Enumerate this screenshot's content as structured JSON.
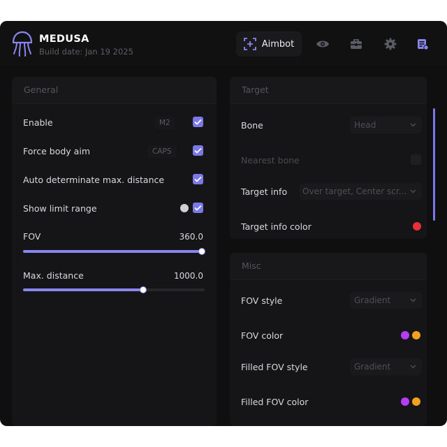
{
  "header": {
    "title": "MEDUSA",
    "build_date": "Build date: Jan 19 2025",
    "tabs": [
      {
        "label": "Aimbot",
        "icon": "crosshair-icon",
        "active": true
      },
      {
        "label": "",
        "icon": "eye-icon"
      },
      {
        "label": "",
        "icon": "toolbox-icon"
      },
      {
        "label": "",
        "icon": "gear-icon"
      },
      {
        "label": "",
        "icon": "config-list-icon"
      }
    ]
  },
  "general": {
    "title": "General",
    "enable": {
      "label": "Enable",
      "key": "M2",
      "checked": true
    },
    "force_body_aim": {
      "label": "Force body aim",
      "key": "CAPS",
      "checked": true
    },
    "auto_max_distance": {
      "label": "Auto determinate max. distance",
      "checked": true
    },
    "show_limit_range": {
      "label": "Show limit range",
      "checked": true
    },
    "fov": {
      "label": "FOV",
      "value": "360.0",
      "fraction": 1.0
    },
    "max_distance": {
      "label": "Max. distance",
      "value": "1000.0",
      "fraction": 0.66
    }
  },
  "target": {
    "title": "Target",
    "bone": {
      "label": "Bone",
      "selected": "Head"
    },
    "nearest_bone": {
      "label": "Nearest bone",
      "checked": false
    },
    "target_info": {
      "label": "Target info",
      "selected": "Over target, Center scr..."
    },
    "target_info_color": {
      "label": "Target info color",
      "color": "#e8303a"
    }
  },
  "misc": {
    "title": "Misc",
    "fov_style": {
      "label": "FOV style",
      "selected": "Gradient"
    },
    "fov_color": {
      "label": "FOV color",
      "colors": [
        "#b43ef0",
        "#f2a11a"
      ]
    },
    "filled_fov_style": {
      "label": "Filled FOV style",
      "selected": "Gradient"
    },
    "filled_fov_color": {
      "label": "Filled FOV color",
      "colors": [
        "#b43ef0",
        "#f2a11a"
      ]
    }
  },
  "theme": {
    "accent": "#7b78e8",
    "background": "#0f0f10"
  }
}
